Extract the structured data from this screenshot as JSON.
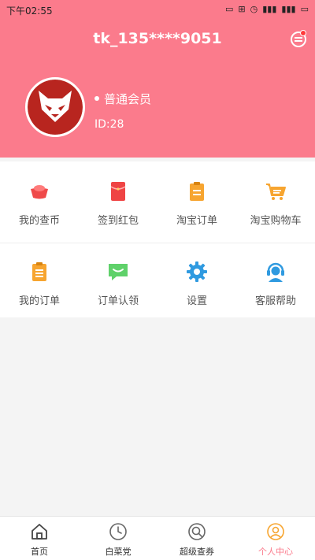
{
  "status_bar": {
    "time": "下午02:55"
  },
  "header": {
    "title": "tk_135****9051"
  },
  "profile": {
    "member_level": "普通会员",
    "id_text": "ID:28"
  },
  "grid": [
    {
      "label": "我的查币",
      "icon": "gold-ingot-icon"
    },
    {
      "label": "签到红包",
      "icon": "red-envelope-icon"
    },
    {
      "label": "淘宝订单",
      "icon": "clipboard-icon"
    },
    {
      "label": "淘宝购物车",
      "icon": "shopping-cart-icon"
    },
    {
      "label": "我的订单",
      "icon": "order-list-icon"
    },
    {
      "label": "订单认领",
      "icon": "chat-bubble-icon"
    },
    {
      "label": "设置",
      "icon": "gear-icon"
    },
    {
      "label": "客服帮助",
      "icon": "customer-service-icon"
    }
  ],
  "tabs": [
    {
      "label": "首页",
      "icon": "home-icon",
      "active": false
    },
    {
      "label": "白菜党",
      "icon": "clock-icon",
      "active": false
    },
    {
      "label": "超级查券",
      "icon": "search-coupon-icon",
      "active": false
    },
    {
      "label": "个人中心",
      "icon": "user-icon",
      "active": true
    }
  ],
  "colors": {
    "brand": "#fb7b8c",
    "background": "#f4f4f4"
  }
}
